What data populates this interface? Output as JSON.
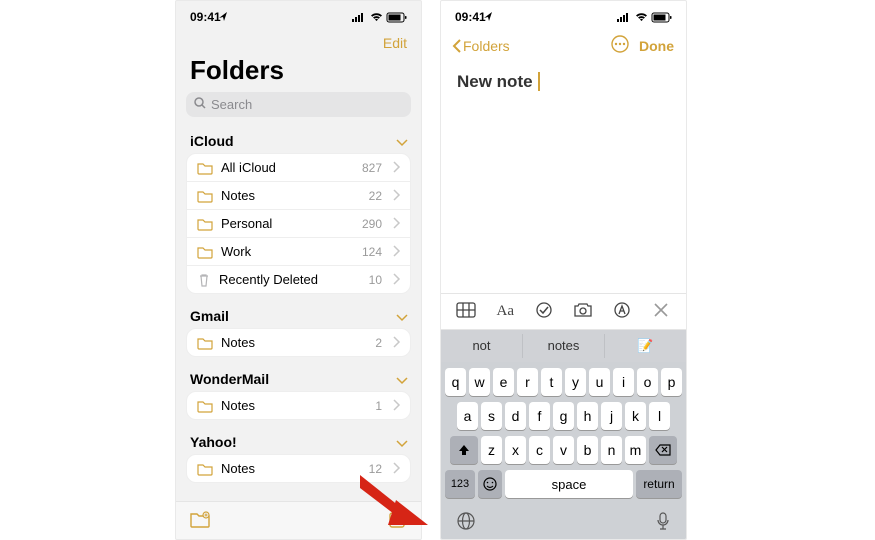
{
  "left": {
    "status": {
      "time": "09:41"
    },
    "nav": {
      "edit": "Edit"
    },
    "title": "Folders",
    "search": {
      "placeholder": "Search"
    },
    "sections": {
      "icloud": {
        "header": "iCloud",
        "rows": {
          "all": {
            "label": "All iCloud",
            "count": "827"
          },
          "notes": {
            "label": "Notes",
            "count": "22"
          },
          "personal": {
            "label": "Personal",
            "count": "290"
          },
          "work": {
            "label": "Work",
            "count": "124"
          },
          "deleted": {
            "label": "Recently Deleted",
            "count": "10"
          }
        }
      },
      "gmail": {
        "header": "Gmail",
        "rows": {
          "notes": {
            "label": "Notes",
            "count": "2"
          }
        }
      },
      "wonder": {
        "header": "WonderMail",
        "rows": {
          "notes": {
            "label": "Notes",
            "count": "1"
          }
        }
      },
      "yahoo": {
        "header": "Yahoo!",
        "rows": {
          "notes": {
            "label": "Notes",
            "count": "12"
          }
        }
      }
    }
  },
  "right": {
    "status": {
      "time": "09:41"
    },
    "nav": {
      "back": "Folders",
      "done": "Done"
    },
    "note": {
      "title": "New note"
    },
    "keyboard": {
      "toolbar": {
        "aa": "Aa"
      },
      "suggestions": {
        "s0": "not",
        "s1": "notes",
        "s2": "📝"
      },
      "row1": {
        "k0": "q",
        "k1": "w",
        "k2": "e",
        "k3": "r",
        "k4": "t",
        "k5": "y",
        "k6": "u",
        "k7": "i",
        "k8": "o",
        "k9": "p"
      },
      "row2": {
        "k0": "a",
        "k1": "s",
        "k2": "d",
        "k3": "f",
        "k4": "g",
        "k5": "h",
        "k6": "j",
        "k7": "k",
        "k8": "l"
      },
      "row3": {
        "k0": "z",
        "k1": "x",
        "k2": "c",
        "k3": "v",
        "k4": "b",
        "k5": "n",
        "k6": "m"
      },
      "row4": {
        "num": "123",
        "space": "space",
        "return": "return"
      }
    }
  }
}
